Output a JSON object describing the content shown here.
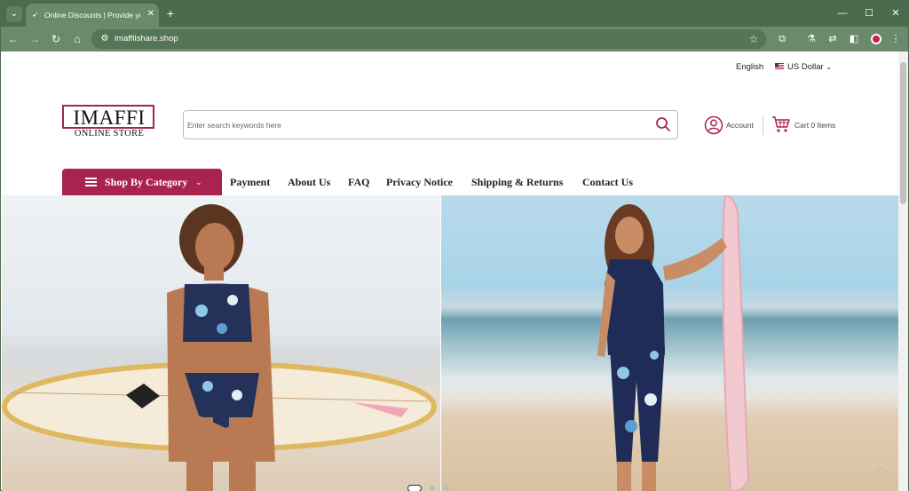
{
  "browser": {
    "tab_title": "Online Discounts | Provide yo",
    "url": "imaffilshare.shop",
    "icons": {
      "tab_menu": "chevron-down-icon",
      "favicon": "site-favicon-icon",
      "tab_close": "close-icon",
      "new_tab": "plus-icon",
      "back": "arrow-left-icon",
      "forward": "arrow-right-icon",
      "reload": "reload-icon",
      "home": "home-icon",
      "site_info": "tune-icon",
      "bookmark": "star-icon",
      "extensions": "puzzle-icon",
      "labs": "flask-icon",
      "translate": "translate-icon",
      "side_panel": "side-panel-icon",
      "profile": "profile-icon",
      "menu": "more-vert-icon"
    }
  },
  "topbar": {
    "language": "English",
    "currency": "US Dollar"
  },
  "header": {
    "logo_main": "IMAFFI",
    "logo_sub": "ONLINE STORE",
    "search_placeholder": "Enter search keywords here",
    "account_label": "Account",
    "cart_label": "Cart 0 Items"
  },
  "nav": {
    "category_button": "Shop By Category",
    "links": [
      "Payment",
      "About Us",
      "FAQ",
      "Privacy Notice",
      "Shipping & Returns",
      "Contact Us"
    ]
  },
  "hero": {
    "slides": 3,
    "active_slide": 1
  },
  "colors": {
    "brand": "#a8234e",
    "browser_frame": "#4a6b4c"
  }
}
